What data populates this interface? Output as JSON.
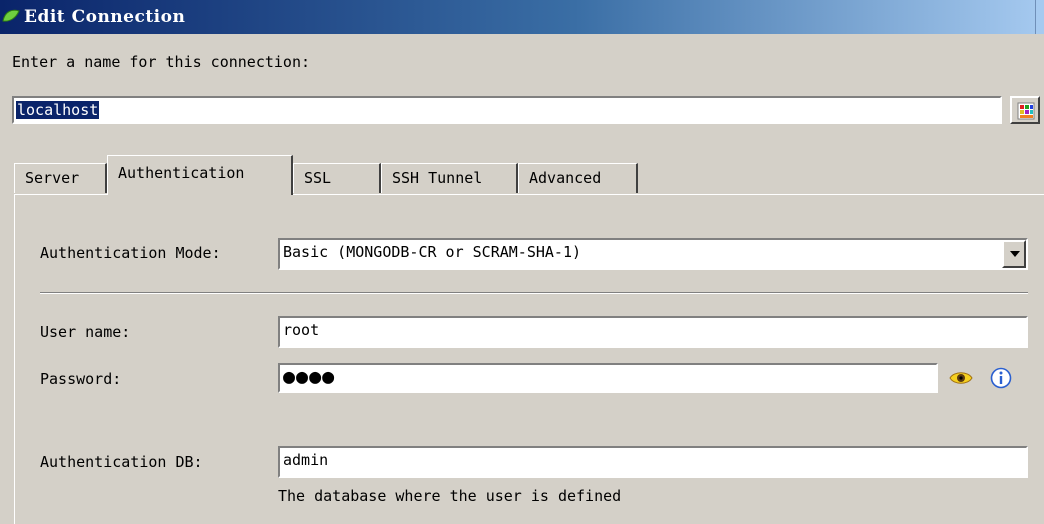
{
  "window": {
    "title": "Edit Connection"
  },
  "connection_name": {
    "label": "Enter a name for this connection:",
    "value": "localhost"
  },
  "tabs": [
    {
      "label": "Server"
    },
    {
      "label": "Authentication"
    },
    {
      "label": "SSL"
    },
    {
      "label": "SSH Tunnel"
    },
    {
      "label": "Advanced"
    }
  ],
  "auth": {
    "mode_label": "Authentication Mode:",
    "mode_value": "Basic (MONGODB-CR or SCRAM-SHA-1)",
    "username_label": "User name:",
    "username_value": "root",
    "password_label": "Password:",
    "password_masked": "●●●●",
    "db_label": "Authentication DB:",
    "db_value": "admin",
    "db_hint": "The database where the user is defined"
  },
  "icons": {
    "app": "mongodb-leaf-icon",
    "color_picker": "color-palette-icon",
    "reveal": "eye-icon",
    "info": "info-icon"
  },
  "colors": {
    "title_start": "#0a246a",
    "title_end": "#a6caf0",
    "face": "#d4d0c8",
    "selection": "#0a246a"
  }
}
